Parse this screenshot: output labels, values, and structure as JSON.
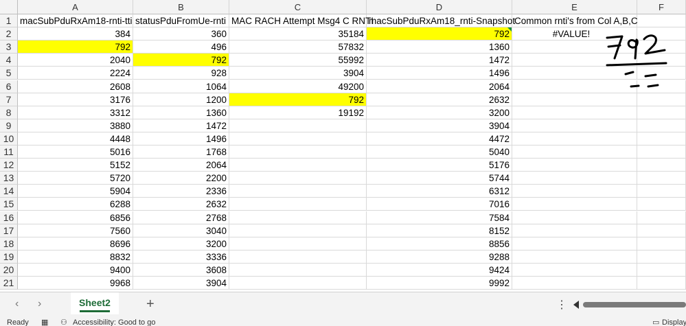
{
  "column_headers": [
    "A",
    "B",
    "C",
    "D",
    "E",
    "F"
  ],
  "row_headers": [
    "1",
    "2",
    "3",
    "4",
    "5",
    "6",
    "7",
    "8",
    "9",
    "10",
    "11",
    "12",
    "13",
    "14",
    "15",
    "16",
    "17",
    "18",
    "19",
    "20",
    "21"
  ],
  "header_row": {
    "A": "macSubPduRxAm18-rnti-tti",
    "B": "statusPduFromUe-rnti",
    "C": "MAC RACH Attempt Msg4 C RNTI",
    "D": "macSubPduRxAm18_rnti-Snapshot",
    "E": "Common rnti's from Col A,B,C"
  },
  "columns": {
    "A": [
      "384",
      "792",
      "2040",
      "2224",
      "2608",
      "3176",
      "3312",
      "3880",
      "4448",
      "5016",
      "5152",
      "5720",
      "5904",
      "6288",
      "6856",
      "7560",
      "8696",
      "8832",
      "9400",
      "9968"
    ],
    "B": [
      "360",
      "496",
      "792",
      "928",
      "1064",
      "1200",
      "1360",
      "1472",
      "1496",
      "1768",
      "2064",
      "2200",
      "2336",
      "2632",
      "2768",
      "3040",
      "3200",
      "3336",
      "3608",
      "3904"
    ],
    "C": [
      "35184",
      "57832",
      "55992",
      "3904",
      "49200",
      "792",
      "19192"
    ],
    "D": [
      "792",
      "1360",
      "1472",
      "1496",
      "2064",
      "2632",
      "3200",
      "3904",
      "4472",
      "5040",
      "5176",
      "5744",
      "6312",
      "7016",
      "7584",
      "8152",
      "8856",
      "9288",
      "9424",
      "9992"
    ]
  },
  "e2_value": "#VALUE!",
  "highlight_color": "#ffff00",
  "annotation_text": "792",
  "sheet_tab": "Sheet2",
  "add_sheet_glyph": "+",
  "nav_prev": "‹",
  "nav_next": "›",
  "menu_glyph": "⋮",
  "status": {
    "ready": "Ready",
    "accessibility": "Accessibility: Good to go",
    "display": "Display"
  }
}
